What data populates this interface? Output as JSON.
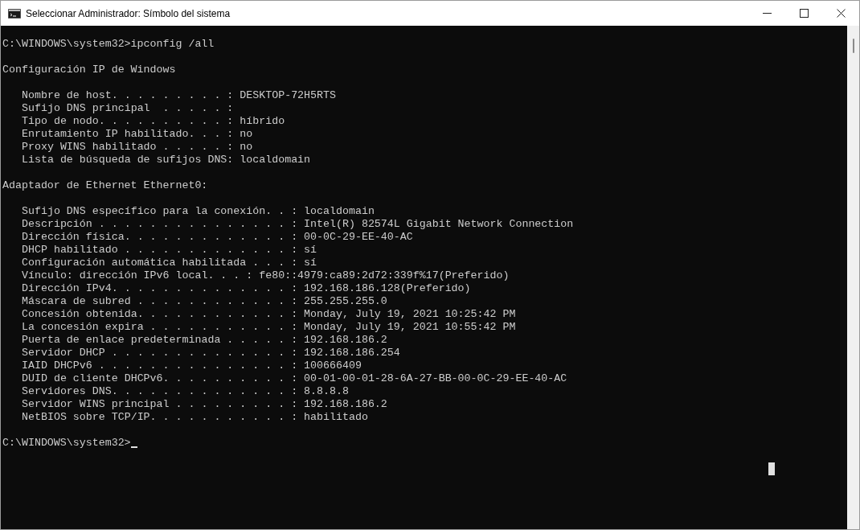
{
  "window": {
    "title": "Seleccionar Administrador: Símbolo del sistema"
  },
  "console": [
    {
      "kind": "prompt",
      "text": "C:\\WINDOWS\\system32>ipconfig /all",
      "cursor": false
    },
    {
      "kind": "heading",
      "text": "Configuración IP de Windows"
    },
    {
      "kind": "entries",
      "lines": [
        "Nombre de host. . . . . . . . . : DESKTOP-72H5RTS",
        "Sufijo DNS principal  . . . . . :",
        "Tipo de nodo. . . . . . . . . . : híbrido",
        "Enrutamiento IP habilitado. . . : no",
        "Proxy WINS habilitado . . . . . : no",
        "Lista de búsqueda de sufijos DNS: localdomain"
      ]
    },
    {
      "kind": "heading",
      "text": "Adaptador de Ethernet Ethernet0:"
    },
    {
      "kind": "entries",
      "lines": [
        "Sufijo DNS específico para la conexión. . : localdomain",
        "Descripción . . . . . . . . . . . . . . . : Intel(R) 82574L Gigabit Network Connection",
        "Dirección física. . . . . . . . . . . . . : 00-0C-29-EE-40-AC",
        "DHCP habilitado . . . . . . . . . . . . . : sí",
        "Configuración automática habilitada . . . : sí",
        "Vínculo: dirección IPv6 local. . . : fe80::4979:ca89:2d72:339f%17(Preferido)",
        "Dirección IPv4. . . . . . . . . . . . . . : 192.168.186.128(Preferido)",
        "Máscara de subred . . . . . . . . . . . . : 255.255.255.0",
        "Concesión obtenida. . . . . . . . . . . . : Monday, July 19, 2021 10:25:42 PM",
        "La concesión expira . . . . . . . . . . . : Monday, July 19, 2021 10:55:42 PM",
        "Puerta de enlace predeterminada . . . . . : 192.168.186.2",
        "Servidor DHCP . . . . . . . . . . . . . . : 192.168.186.254",
        "IAID DHCPv6 . . . . . . . . . . . . . . . : 100666409",
        "DUID de cliente DHCPv6. . . . . . . . . . : 00-01-00-01-28-6A-27-BB-00-0C-29-EE-40-AC",
        "Servidores DNS. . . . . . . . . . . . . . : 8.8.8.8",
        "Servidor WINS principal . . . . . . . . . : 192.168.186.2",
        "NetBIOS sobre TCP/IP. . . . . . . . . . . : habilitado"
      ]
    },
    {
      "kind": "prompt",
      "text": "C:\\WINDOWS\\system32>",
      "cursor": true
    }
  ]
}
